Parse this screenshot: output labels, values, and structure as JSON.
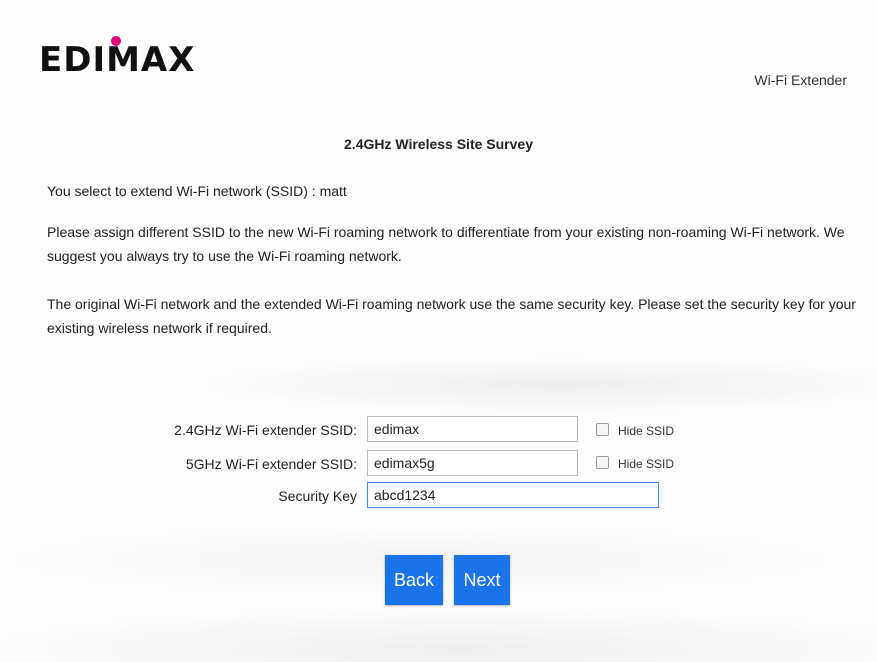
{
  "header": {
    "logo_text": "EDIMAX",
    "product_name": "Wi-Fi Extender"
  },
  "survey": {
    "title": "2.4GHz Wireless Site Survey",
    "selected_text": "You select to extend Wi-Fi network (SSID) :  matt",
    "paragraph_ssid": "Please assign different SSID to the new Wi-Fi roaming network to differentiate from your existing non-roaming Wi-Fi network. We suggest you always try to use the Wi-Fi roaming network.",
    "paragraph_key": "The original Wi-Fi network and the extended Wi-Fi roaming network use the same security key. Please set the security key for your existing wireless network if required."
  },
  "form": {
    "ssid24_label": "2.4GHz Wi-Fi extender SSID:",
    "ssid24_value": "edimax",
    "ssid5_label": "5GHz Wi-Fi extender SSID:",
    "ssid5_value": "edimax5g",
    "key_label": "Security Key",
    "key_value": "abcd1234",
    "hide_ssid_label": "Hide SSID"
  },
  "buttons": {
    "back": "Back",
    "next": "Next"
  },
  "colors": {
    "button_blue": "#1a73e8",
    "logo_dot": "#e3007b"
  }
}
